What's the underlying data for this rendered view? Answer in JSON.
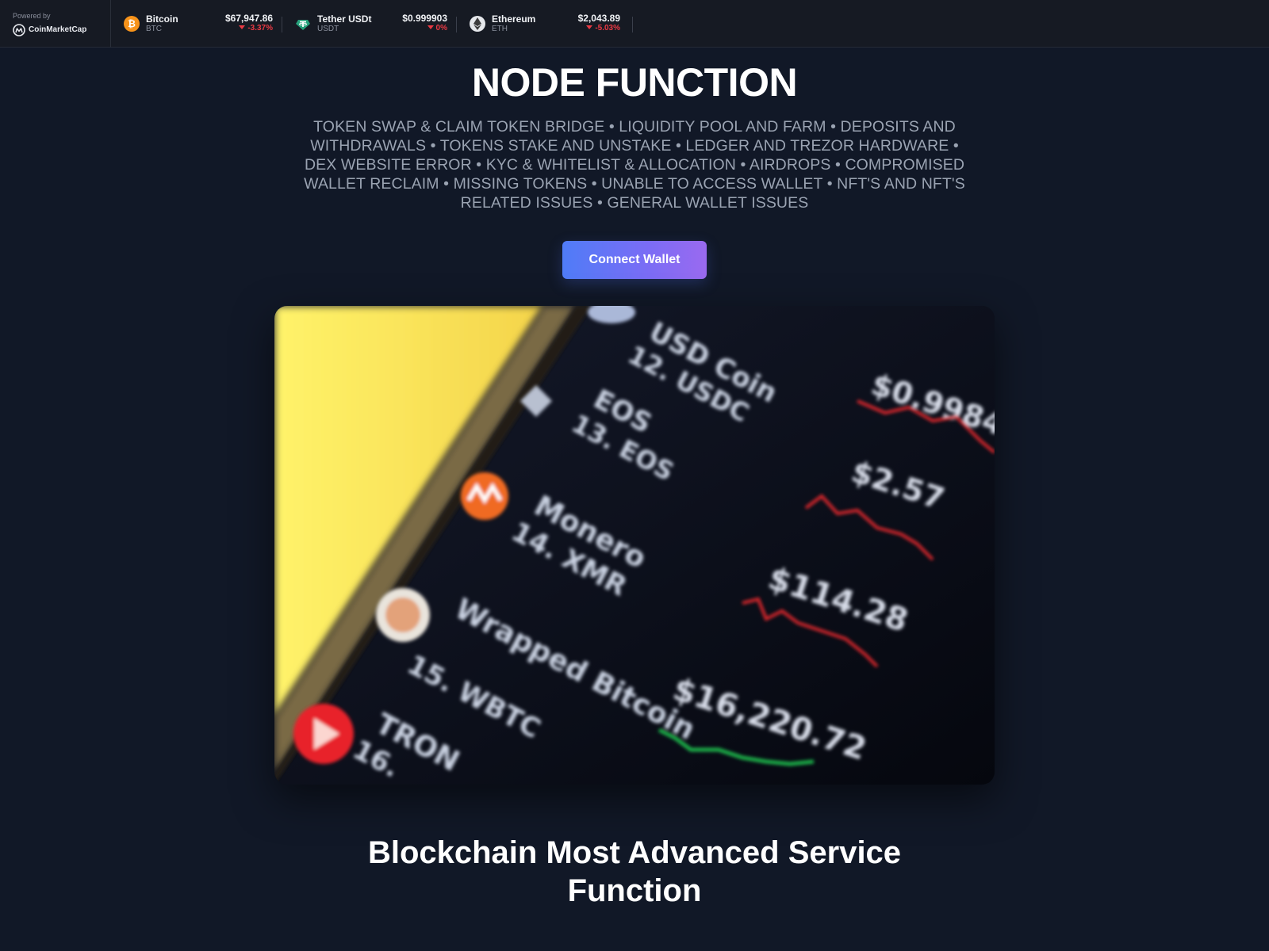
{
  "ticker": {
    "powered_by": "Powered by",
    "brand": "CoinMarketCap",
    "coins": [
      {
        "name": "Bitcoin",
        "symbol": "BTC",
        "price": "$67,947.86",
        "change": "-3.37%",
        "icon": "bitcoin-icon",
        "color": "#f7931a"
      },
      {
        "name": "Tether USDt",
        "symbol": "USDT",
        "price": "$0.999903",
        "change": "0%",
        "icon": "tether-icon",
        "color": "#26a17b"
      },
      {
        "name": "Ethereum",
        "symbol": "ETH",
        "price": "$2,043.89",
        "change": "-5.03%",
        "icon": "ethereum-icon",
        "color": "#e5e7eb"
      }
    ],
    "negative_color": "#ea3943"
  },
  "hero": {
    "title": "NODE FUNCTION",
    "services": "TOKEN SWAP & CLAIM TOKEN BRIDGE • LIQUIDITY POOL AND FARM • DEPOSITS AND WITHDRAWALS • TOKENS STAKE AND UNSTAKE • LEDGER AND TREZOR HARDWARE • DEX WEBSITE ERROR • KYC & WHITELIST & ALLOCATION • AIRDROPS • COMPROMISED WALLET RECLAIM • MISSING TOKENS • UNABLE TO ACCESS WALLET • NFT'S AND NFT'S RELATED ISSUES • GENERAL WALLET ISSUES",
    "connect_label": "Connect Wallet",
    "accent_gradient": [
      "#4f7cf7",
      "#9a6af0"
    ]
  },
  "photo": {
    "rows": [
      {
        "name": "USD Coin",
        "rank": "12. USDC",
        "price": "$0.9984"
      },
      {
        "name": "EOS",
        "rank": "13. EOS",
        "price": "$2.57"
      },
      {
        "name": "Monero",
        "rank": "14. XMR",
        "price": "$114.28"
      },
      {
        "name": "Wrapped Bitcoin",
        "rank": "15. WBTC",
        "price": "$16,220.72"
      },
      {
        "name": "TRON",
        "rank": "16.",
        "price": ""
      }
    ]
  },
  "section": {
    "heading": "Blockchain Most Advanced Service Function"
  }
}
